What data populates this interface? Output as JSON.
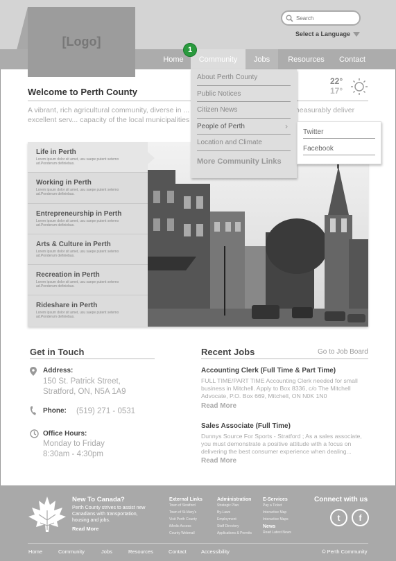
{
  "header": {
    "logo": "[Logo]",
    "search_placeholder": "Search",
    "language": "Select a Language",
    "badge": "1"
  },
  "nav": {
    "items": [
      "Home",
      "Community",
      "Jobs",
      "Resources",
      "Contact"
    ]
  },
  "dropdown": {
    "items": [
      "About Perth County",
      "Public Notices",
      "Citizen News",
      "People of Perth",
      "Location and Climate"
    ],
    "more": "More Community Links",
    "submenu": [
      "Twitter",
      "Facebook"
    ]
  },
  "welcome": {
    "title": "Welcome to Perth County",
    "intro": "A vibrant, rich agricultural community, diverse in ... unty will strive to efficiently and measurably deliver excellent serv... capacity of the local municipalities that Council represents."
  },
  "weather": {
    "high": "22°",
    "low": "17°",
    "icon": "sun-icon"
  },
  "sidebar": {
    "desc": "Lorem ipsum dolor sit amet, usu saepe putent setemo ad.Ponderum definiebas.",
    "items": [
      {
        "title": "Life in Perth"
      },
      {
        "title": "Working in Perth"
      },
      {
        "title": "Entrepreneurship in Perth"
      },
      {
        "title": "Arts & Culture in Perth"
      },
      {
        "title": "Recreation in Perth"
      },
      {
        "title": "Rideshare in Perth"
      }
    ]
  },
  "contact": {
    "title": "Get in Touch",
    "address_label": "Address:",
    "address_1": "150 St. Patrick Street,",
    "address_2": "Stratford, ON, N5A 1A9",
    "phone_label": "Phone:",
    "phone": "(519) 271 - 0531",
    "hours_label": "Office Hours:",
    "hours_1": "Monday to Friday",
    "hours_2": "8:30am - 4:30pm"
  },
  "jobs": {
    "title": "Recent Jobs",
    "board_link": "Go to Job Board",
    "read_more": "Read More",
    "list": [
      {
        "title": "Accounting Clerk (Full Time & Part Time)",
        "desc": "FULL TIME/PART TIME Accounting Clerk needed for small business in Mitchell. Apply to Box 8336, c/o The Mitchell Advocate, P.O. Box 669, Mitchell, ON N0K 1N0"
      },
      {
        "title": "Sales Associate (Full Time)",
        "desc": "Dunnys Source For Sports - Stratford ; As a sales associate, you must demonstrate a positive attitude with a focus on delivering the best consumer experience when dealing..."
      }
    ]
  },
  "footer": {
    "newcomer_title": "New To Canada?",
    "newcomer_desc": "Perth County strives to assist new Canadians with transportation, housing and jobs.",
    "newcomer_read": "Read More",
    "columns": {
      "external": {
        "heading": "External Links",
        "links": [
          "Town of Stratford",
          "Town of St.Mary's",
          "Visit Perth County",
          "iMedic Access",
          "County Webmail"
        ]
      },
      "admin": {
        "heading": "Administration",
        "links": [
          "Strategic Plan",
          "By-Laws",
          "Employment",
          "Staff Directory",
          "Applications & Permits"
        ]
      },
      "eservices": {
        "heading": "E-Services",
        "links": [
          "Pay a Ticket",
          "Interactive Map",
          "Interactive Maps"
        ]
      },
      "news": {
        "heading": "News",
        "links": [
          "Read Latest News"
        ]
      }
    },
    "connect": "Connect with us",
    "twitter_glyph": "t",
    "facebook_glyph": "f",
    "bottom_links": [
      "Home",
      "Community",
      "Jobs",
      "Resources",
      "Contact",
      "Accessibility"
    ],
    "copyright": "© Perth Community"
  }
}
